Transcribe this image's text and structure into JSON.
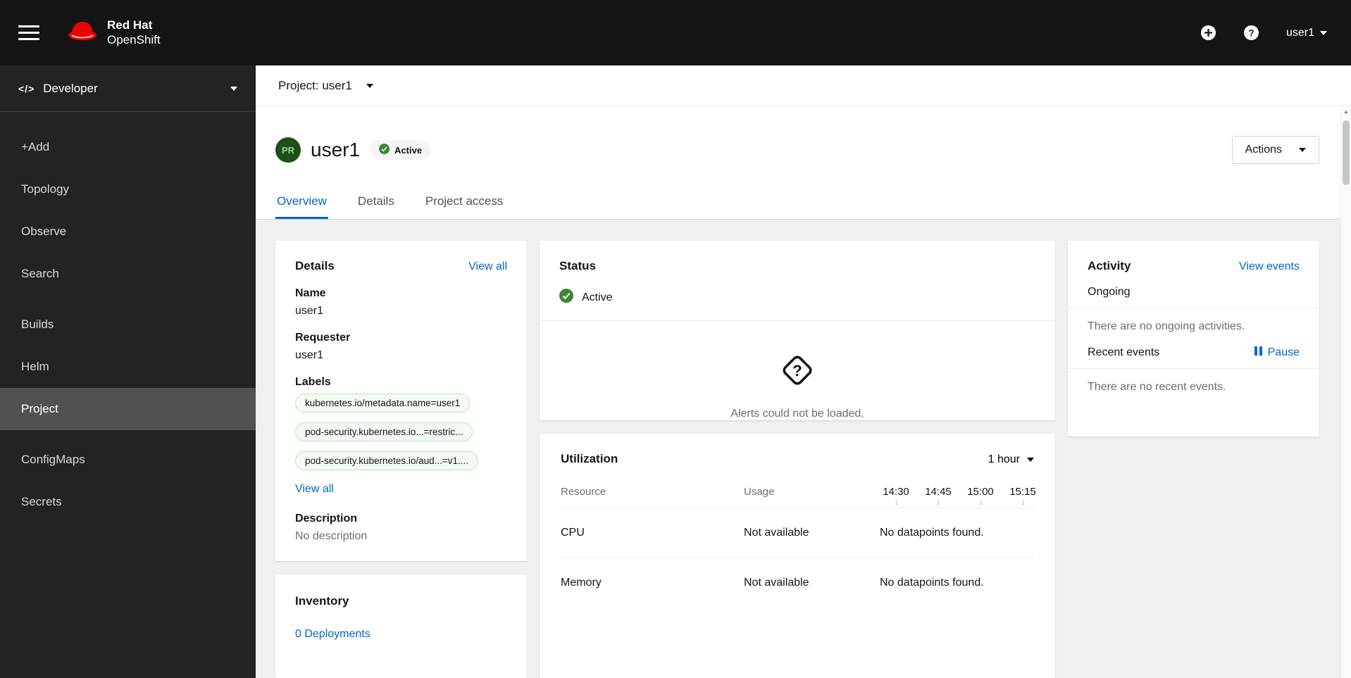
{
  "colors": {
    "accent": "#0066cc",
    "success": "#3e8635",
    "brand_red": "#ee0000"
  },
  "masthead": {
    "brand": {
      "line1": "Red Hat",
      "line2": "OpenShift"
    },
    "username": "user1"
  },
  "sidebar": {
    "perspective": "Developer",
    "items": [
      {
        "label": "+Add"
      },
      {
        "label": "Topology"
      },
      {
        "label": "Observe"
      },
      {
        "label": "Search"
      },
      {
        "label": "Builds"
      },
      {
        "label": "Helm"
      },
      {
        "label": "Project"
      },
      {
        "label": "ConfigMaps"
      },
      {
        "label": "Secrets"
      }
    ]
  },
  "project_bar": {
    "label": "Project: user1"
  },
  "page_header": {
    "badge": "PR",
    "title": "user1",
    "status": "Active",
    "actions_label": "Actions"
  },
  "tabs": [
    {
      "label": "Overview"
    },
    {
      "label": "Details"
    },
    {
      "label": "Project access"
    }
  ],
  "details_card": {
    "title": "Details",
    "view_all": "View all",
    "name_label": "Name",
    "name_value": "user1",
    "requester_label": "Requester",
    "requester_value": "user1",
    "labels_label": "Labels",
    "labels": [
      "kubernetes.io/metadata.name=user1",
      "pod-security.kubernetes.io...=restric...",
      "pod-security.kubernetes.io/aud...=v1...."
    ],
    "labels_view_all": "View all",
    "description_label": "Description",
    "description_value": "No description"
  },
  "status_card": {
    "title": "Status",
    "status": "Active",
    "alerts_message": "Alerts could not be loaded."
  },
  "utilization_card": {
    "title": "Utilization",
    "duration": "1 hour",
    "col_resource": "Resource",
    "col_usage": "Usage",
    "times": [
      "14:30",
      "14:45",
      "15:00",
      "15:15"
    ],
    "rows": [
      {
        "name": "CPU",
        "usage": "Not available",
        "datapoints": "No datapoints found."
      },
      {
        "name": "Memory",
        "usage": "Not available",
        "datapoints": "No datapoints found."
      }
    ]
  },
  "activity_card": {
    "title": "Activity",
    "view_events": "View events",
    "ongoing_label": "Ongoing",
    "ongoing_empty": "There are no ongoing activities.",
    "recent_label": "Recent events",
    "pause_label": "Pause",
    "recent_empty": "There are no recent events."
  },
  "inventory_card": {
    "title": "Inventory",
    "deployments_link": "0 Deployments"
  }
}
